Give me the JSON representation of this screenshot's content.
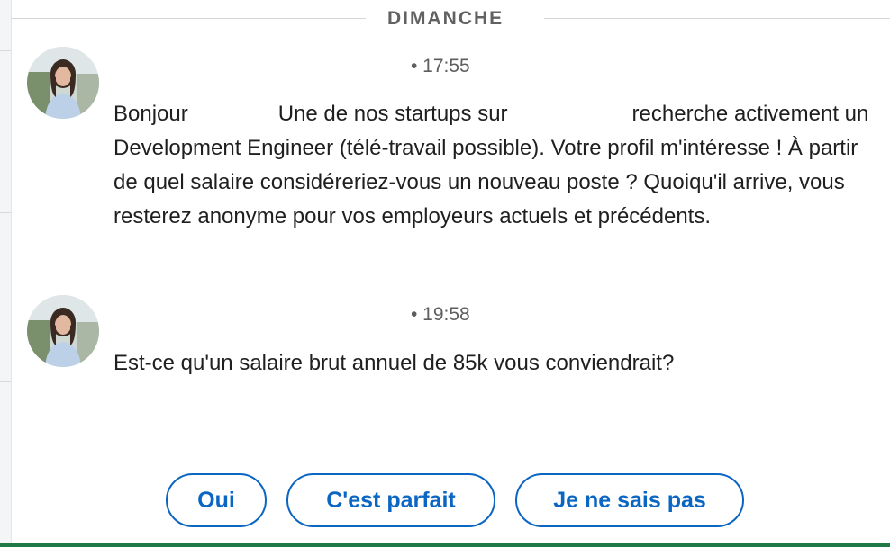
{
  "day_divider": "DIMANCHE",
  "messages": [
    {
      "time": "• 17:55",
      "text_part1": "Bonjour",
      "text_part2": "Une de nos startups sur",
      "text_part3": "recherche activement un Development Engineer (télé-travail possible). Votre profil m'intéresse ! À partir de quel salaire considéreriez-vous un nouveau poste ? Quoiqu'il arrive, vous resterez anonyme pour vos employeurs actuels et précédents."
    },
    {
      "time": "• 19:58",
      "text": "Est-ce qu'un salaire brut annuel de 85k vous conviendrait?"
    }
  ],
  "quick_replies": [
    "Oui",
    "C'est parfait",
    "Je ne sais pas"
  ],
  "colors": {
    "accent": "#0a66c2",
    "bottom_bar": "#1f7a45",
    "muted": "#5e5e5e"
  }
}
